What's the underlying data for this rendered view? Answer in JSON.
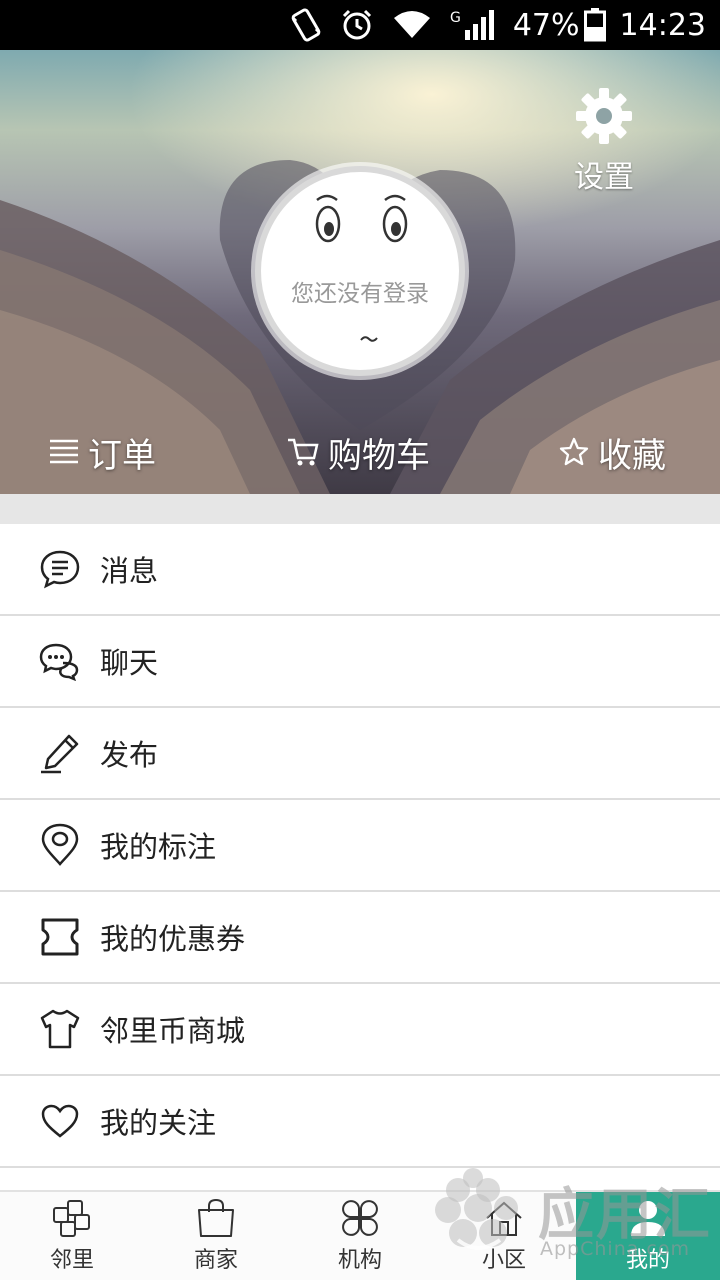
{
  "status_bar": {
    "battery": "47%",
    "network": "G",
    "time": "14:23",
    "icons": [
      "vibrate-icon",
      "alarm-icon",
      "wifi-icon",
      "signal-icon",
      "battery-icon"
    ]
  },
  "header": {
    "settings_label": "设置",
    "login_prompt": "您还没有登录",
    "quick_links": [
      {
        "label": "订单",
        "icon": "list-icon"
      },
      {
        "label": "购物车",
        "icon": "cart-icon"
      },
      {
        "label": "收藏",
        "icon": "star-icon"
      }
    ]
  },
  "menu": [
    {
      "label": "消息",
      "icon": "message-icon"
    },
    {
      "label": "聊天",
      "icon": "chat-icon"
    },
    {
      "label": "发布",
      "icon": "pencil-icon"
    },
    {
      "label": "我的标注",
      "icon": "location-pin-icon"
    },
    {
      "label": "我的优惠券",
      "icon": "coupon-icon"
    },
    {
      "label": "邻里币商城",
      "icon": "tshirt-icon"
    },
    {
      "label": "我的关注",
      "icon": "heart-icon"
    }
  ],
  "bottom_nav": [
    {
      "label": "邻里",
      "icon": "neighborhood-icon",
      "active": false
    },
    {
      "label": "商家",
      "icon": "shopping-bag-icon",
      "active": false
    },
    {
      "label": "机构",
      "icon": "clover-icon",
      "active": false
    },
    {
      "label": "小区",
      "icon": "home-icon",
      "active": false
    },
    {
      "label": "我的",
      "icon": "user-icon",
      "active": true
    }
  ],
  "watermark": {
    "cn": "应用汇",
    "en": "AppChina.com"
  },
  "colors": {
    "accent": "#2aa88e",
    "divider": "#dddddd",
    "section_gap": "#e6e6e6"
  }
}
